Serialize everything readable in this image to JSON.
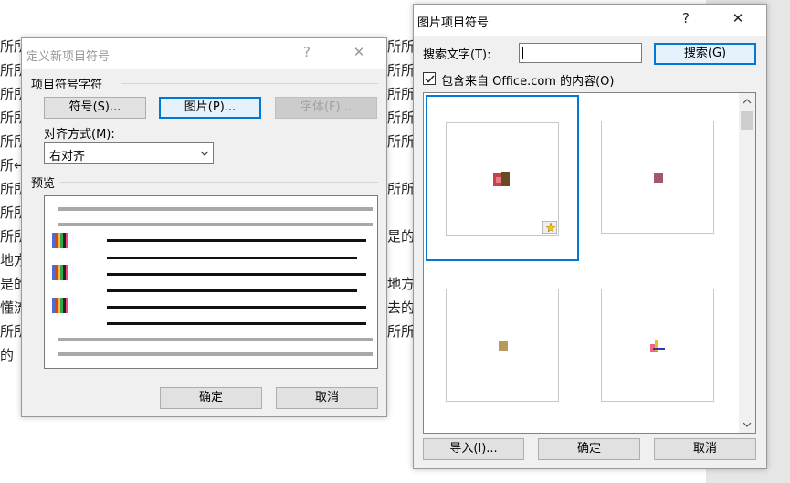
{
  "document": {
    "lines": [
      {
        "text": "所所"
      },
      {
        "text": "所所"
      },
      {
        "text": "所所"
      },
      {
        "text": "所所"
      },
      {
        "text": "所所"
      },
      {
        "text": "所↵"
      },
      {
        "text": "所所"
      },
      {
        "text": "所所"
      },
      {
        "text": "所所"
      },
      {
        "text": "地方"
      },
      {
        "text": "是的"
      },
      {
        "text": "懂流"
      },
      {
        "text": "所所"
      },
      {
        "text": "的"
      }
    ],
    "right_fragments": [
      {
        "text": "所所"
      },
      {
        "text": "所所"
      },
      {
        "text": "所所"
      },
      {
        "text": "所所"
      },
      {
        "text": "所所"
      },
      {
        "text": "所所"
      },
      {
        "text": "是的"
      },
      {
        "text": "地方"
      },
      {
        "text": "去的"
      },
      {
        "text": "所所"
      }
    ]
  },
  "define_bullet_dialog": {
    "title": "定义新项目符号",
    "help_label": "?",
    "close_label": "✕",
    "bullet_char_label": "项目符号字符",
    "symbol_button": "符号(S)...",
    "picture_button": "图片(P)...",
    "font_button": "字体(F)...",
    "alignment_label": "对齐方式(M):",
    "alignment_value": "右对齐",
    "preview_label": "预览",
    "ok_button": "确定",
    "cancel_button": "取消"
  },
  "picture_bullet_dialog": {
    "title": "图片项目符号",
    "help_label": "?",
    "close_label": "✕",
    "search_label": "搜索文字(T):",
    "search_value": "",
    "search_button": "搜索(G)",
    "include_office_label": "包含来自 Office.com 的内容(O)",
    "include_office_checked": true,
    "import_button": "导入(I)...",
    "ok_button": "确定",
    "cancel_button": "取消",
    "gallery": [
      {
        "name": "bullet-image-1",
        "selected": true
      },
      {
        "name": "bullet-image-2",
        "selected": false
      },
      {
        "name": "bullet-image-3",
        "selected": false
      },
      {
        "name": "bullet-image-4",
        "selected": false
      }
    ]
  },
  "colors": {
    "accent": "#0078d7",
    "dialog_bg": "#f0f0f0",
    "button_bg": "#e1e1e1"
  }
}
